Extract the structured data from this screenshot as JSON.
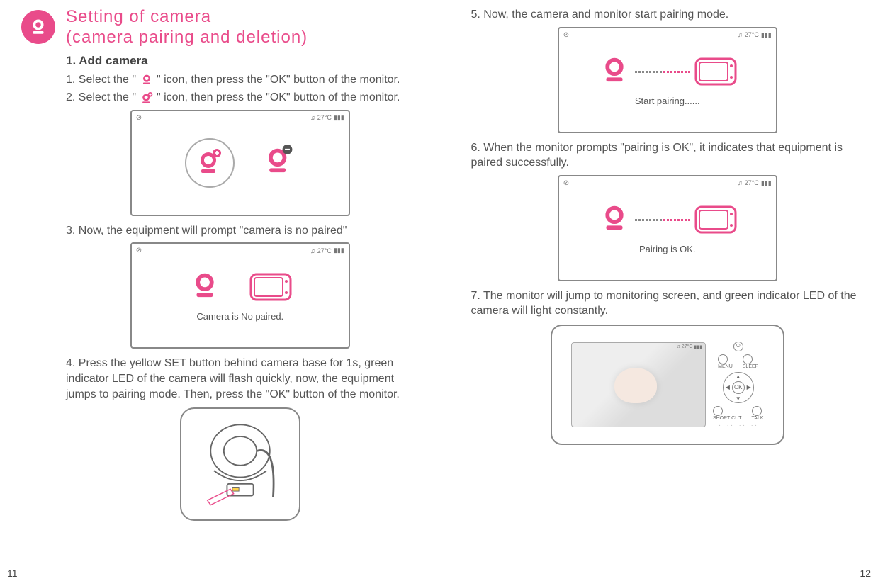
{
  "header": {
    "title_line1": "Setting of camera",
    "title_line2": "(camera pairing and deletion)"
  },
  "section_title": "1. Add camera",
  "left_steps": {
    "s1": "1. Select the \" ",
    "s1b": " \" icon, then press the \"OK\" button of the monitor.",
    "s2": "2. Select the \" ",
    "s2b": "\" icon, then press the \"OK\" button of the monitor.",
    "s3": "3. Now, the equipment will prompt \"camera is no paired\"",
    "s4": "4. Press the yellow SET button behind camera base for 1s, green indicator LED of the camera will flash quickly, now, the equipment jumps to pairing mode. Then, press the \"OK\" button of the monitor."
  },
  "right_steps": {
    "s5": "5. Now, the camera and monitor start pairing mode.",
    "s6": "6. When the monitor prompts \"pairing is OK\", it indicates that equipment is paired successfully.",
    "s7": "7. The monitor will jump to monitoring screen, and green indicator LED of the camera will light constantly."
  },
  "screen_status": {
    "temp": "27°C",
    "music": "♫",
    "signal": "▮▮▮",
    "wifi": "⊘"
  },
  "labels": {
    "camera_no_paired": "Camera is No paired.",
    "start_pairing": "Start pairing......",
    "pairing_ok": "Pairing is OK."
  },
  "monitor_buttons": {
    "menu": "MENU",
    "sleep": "SLEEP",
    "ok": "OK",
    "shortcut": "SHORT CUT",
    "talk": "TALK"
  },
  "page_numbers": {
    "left": "11",
    "right": "12"
  }
}
